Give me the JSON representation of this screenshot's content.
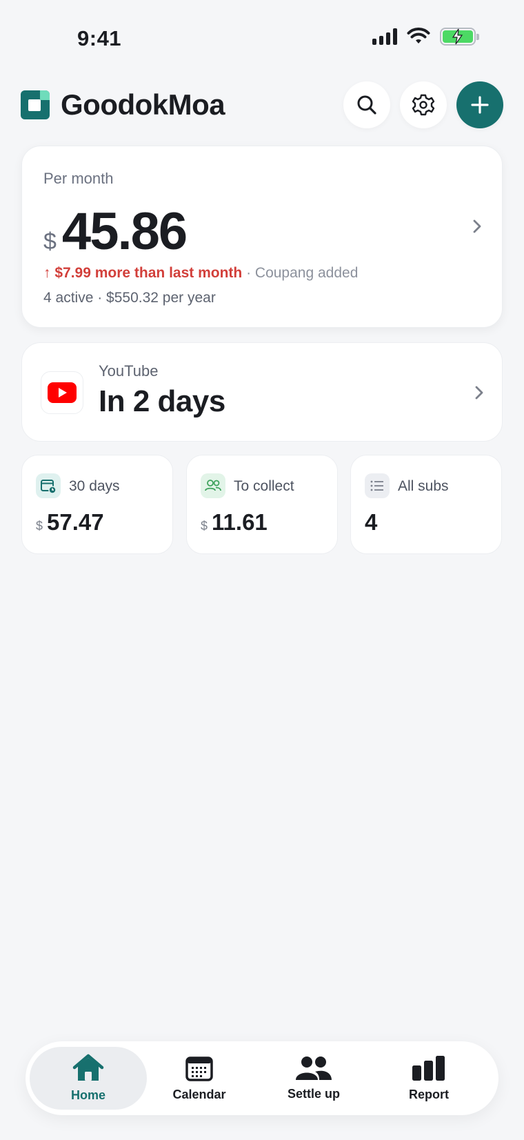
{
  "status_bar": {
    "time": "9:41"
  },
  "header": {
    "app_name": "GoodokMoa"
  },
  "colors": {
    "brand": "#17706e",
    "accent_mint": "#6fdcbb",
    "increase": "#d23f3a",
    "youtube": "#ff0000"
  },
  "summary": {
    "label": "Per month",
    "currency": "$",
    "amount": "45.86",
    "delta": "↑ $7.99 more than last month",
    "delta_note": " · Coupang added",
    "subline": "4 active · $550.32 per year"
  },
  "next_payment": {
    "service": "YouTube",
    "when": "In 2 days",
    "icon": "youtube-logo"
  },
  "stats": [
    {
      "icon": "calendar-clock-icon",
      "label": "30 days",
      "currency": "$",
      "value": "57.47"
    },
    {
      "icon": "people-icon",
      "label": "To collect",
      "currency": "$",
      "value": "11.61"
    },
    {
      "icon": "list-icon",
      "label": "All subs",
      "currency": "",
      "value": "4"
    }
  ],
  "nav": {
    "items": [
      {
        "label": "Home",
        "icon": "home-icon",
        "active": true
      },
      {
        "label": "Calendar",
        "icon": "calendar-icon",
        "active": false
      },
      {
        "label": "Settle up",
        "icon": "people-icon",
        "active": false
      },
      {
        "label": "Report",
        "icon": "bar-chart-icon",
        "active": false
      }
    ]
  }
}
